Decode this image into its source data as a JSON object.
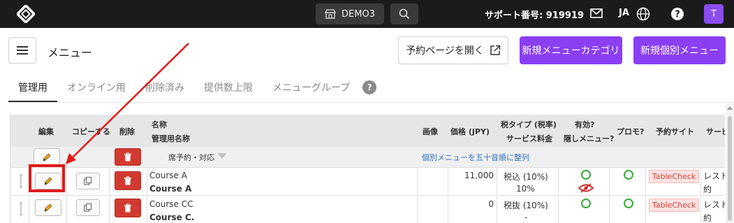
{
  "topbar": {
    "store": "DEMO3",
    "support": "サポート番号: 919919",
    "lang": "JA",
    "avatar": "T"
  },
  "header": {
    "title": "メニュー",
    "open_reservation": "予約ページを開く",
    "new_category": "新規メニューカテゴリ",
    "new_item": "新規個別メニュー"
  },
  "tabs": [
    {
      "label": "管理用"
    },
    {
      "label": "オンライン用"
    },
    {
      "label": "削除済み"
    },
    {
      "label": "提供数上限"
    },
    {
      "label": "メニューグループ"
    }
  ],
  "table": {
    "headers": {
      "edit": "編集",
      "copy": "コピーする",
      "delete": "削除",
      "name": "名称",
      "admin_name": "管理用名称",
      "image": "画像",
      "price": "価格 (JPY)",
      "tax": "税タイプ (税率)",
      "service": "サービス料金",
      "valid": "有効?",
      "hidden": "隠しメニュー?",
      "promo": "プロモ?",
      "site": "予約サイト",
      "more": "サービ"
    },
    "category": "席予約・対応",
    "sort_link": "個別メニューを五十音順に整列",
    "rows": [
      {
        "name": "Course A",
        "admin_name": "Course A",
        "price": "11,000",
        "tax": "税込 (10%)",
        "service": "10%",
        "site": "TableCheck",
        "more1": "レスト",
        "more2": "約"
      },
      {
        "name": "Course CC",
        "admin_name": "Course C.",
        "price": "0",
        "tax": "税抜 (10%)",
        "service": "-",
        "site": "TableCheck",
        "more1": "レスト",
        "more2": "約"
      }
    ]
  },
  "colors": {
    "accent": "#8a3ff2",
    "delete": "#d33a2f",
    "ok": "#3aa83a",
    "annotation": "#e01919"
  }
}
